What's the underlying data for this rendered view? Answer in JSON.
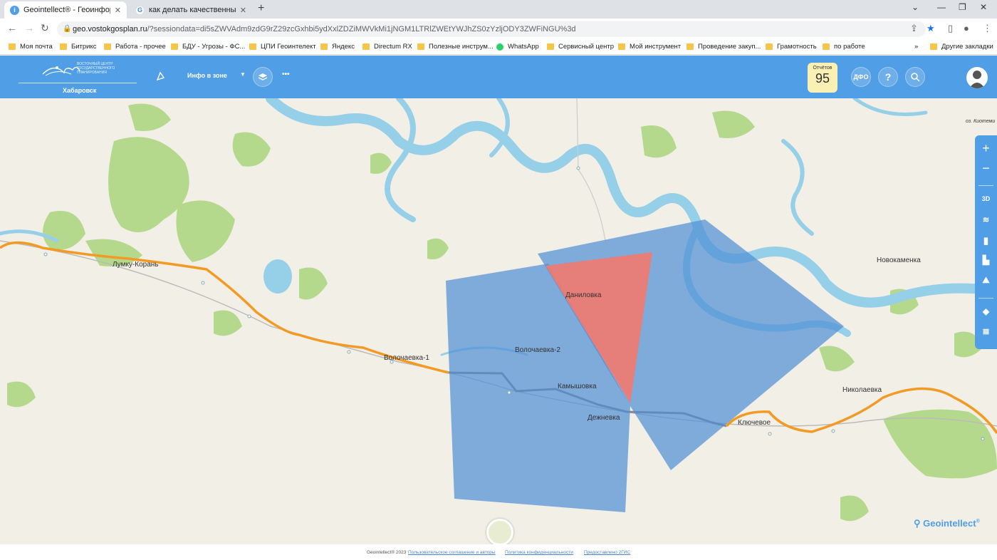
{
  "browser": {
    "tabs": [
      {
        "title": "Geointellect® - Геоинформацио",
        "active": true
      },
      {
        "title": "как делать качественные снимк",
        "active": false
      }
    ],
    "url_host": "geo.vostokgosplan.ru",
    "url_rest": "/?sessiondata=di5sZWVAdm9zdG9rZ29zcGxhbi5ydXxlZDZiMWVkMi1jNGM1LTRlZWEtYWJhZS0zYzljODY3ZWFiNGU%3d",
    "bookmarks": [
      {
        "label": "Моя почта",
        "icon": "folder"
      },
      {
        "label": "Битрикс",
        "icon": "folder"
      },
      {
        "label": "Работа - прочее",
        "icon": "folder"
      },
      {
        "label": "БДУ - Угрозы - ФС...",
        "icon": "folder"
      },
      {
        "label": "ЦПИ Геоинтелект",
        "icon": "folder"
      },
      {
        "label": "Яндекс",
        "icon": "folder"
      },
      {
        "label": "Directum RX",
        "icon": "folder"
      },
      {
        "label": "Полезные инструм...",
        "icon": "folder"
      },
      {
        "label": "WhatsApp",
        "icon": "whatsapp"
      },
      {
        "label": "Сервисный центр",
        "icon": "folder"
      },
      {
        "label": "Мой инструмент",
        "icon": "folder"
      },
      {
        "label": "Проведение закуп...",
        "icon": "folder"
      },
      {
        "label": "Грамотность",
        "icon": "folder"
      },
      {
        "label": "по работе",
        "icon": "folder"
      }
    ],
    "more": "»",
    "other_bookmarks": "Другие закладки"
  },
  "app": {
    "logo_text": "ВОСТОЧНЫЙ ЦЕНТР ГОСУДАРСТВЕННОГО ПЛАНИРОВАНИЯ",
    "city": "Хабаровск",
    "info_zone": "Инфо в зоне",
    "more": "•••",
    "reports_label": "Отчётов",
    "reports_count": "95",
    "region_button": "ДФО",
    "help_button": "?"
  },
  "map": {
    "places": [
      {
        "name": "Лумку-Корань"
      },
      {
        "name": "Волочаевка-1"
      },
      {
        "name": "Волочаевка-2"
      },
      {
        "name": "Даниловка"
      },
      {
        "name": "Камышовка"
      },
      {
        "name": "Дежневка"
      },
      {
        "name": "Ключевое"
      },
      {
        "name": "Николаевка"
      },
      {
        "name": "Новокаменка"
      },
      {
        "name": "оз. Киотеми"
      }
    ],
    "colors": {
      "background": "#f2efe6",
      "water": "#96cfe8",
      "forest": "#b4d98c",
      "road": "#f39a24",
      "rail": "#888888",
      "zone_blue": "#4f8fd6",
      "zone_red": "#f27a6e"
    }
  },
  "controls": {
    "zoom_in": "+",
    "zoom_out": "−",
    "mode_3d": "3D"
  },
  "branding": "Geointellect",
  "footer": {
    "copyright": "Geointellect® 2023",
    "terms": "Пользовательское соглашение и авторы",
    "privacy": "Политика конфиденциальности",
    "provider": "Предоставлено 2ГИС"
  }
}
